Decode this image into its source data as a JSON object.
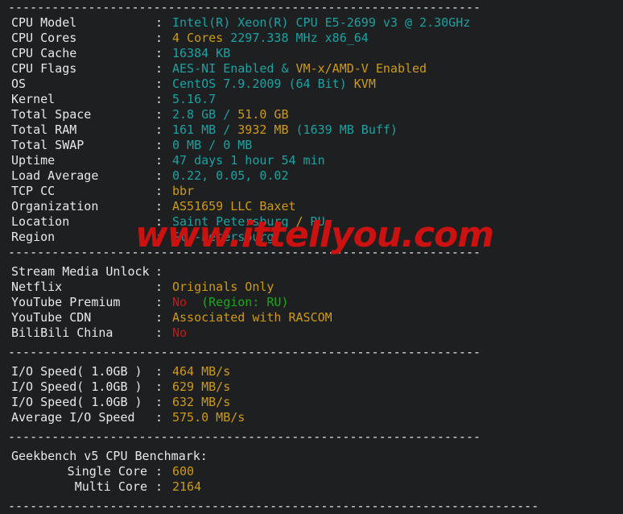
{
  "terminal": {
    "separator": "-----------------------------------------------------------------",
    "separator_long": "-------------------------------------------------------------------------"
  },
  "watermark": {
    "text": "www.ittellyou.com",
    "color": "#cc1111"
  },
  "colors": {
    "background": "#1d1f21",
    "label": "#e8e8e8",
    "cyan": "#1ba2a2",
    "amber": "#cf9a14",
    "red": "#cc1515",
    "green": "#1aa81a"
  },
  "system": {
    "rows": [
      {
        "label": "CPU Model",
        "parts": [
          {
            "text": "Intel(R) Xeon(R) CPU E5-2699 v3 @ 2.30GHz",
            "color": "cy"
          }
        ]
      },
      {
        "label": "CPU Cores",
        "parts": [
          {
            "text": "4 Cores ",
            "color": "am"
          },
          {
            "text": "2297.338 MHz x86_64",
            "color": "cy"
          }
        ]
      },
      {
        "label": "CPU Cache",
        "parts": [
          {
            "text": "16384 KB",
            "color": "cy"
          }
        ]
      },
      {
        "label": "CPU Flags",
        "parts": [
          {
            "text": "AES-NI Enabled ",
            "color": "cy"
          },
          {
            "text": "& ",
            "color": "cy"
          },
          {
            "text": "VM-x/AMD-V Enabled",
            "color": "am"
          }
        ]
      },
      {
        "label": "OS",
        "parts": [
          {
            "text": "CentOS 7.9.2009 (64 Bit) ",
            "color": "cy"
          },
          {
            "text": "KVM",
            "color": "am"
          }
        ]
      },
      {
        "label": "Kernel",
        "parts": [
          {
            "text": "5.16.7",
            "color": "cy"
          }
        ]
      },
      {
        "label": "Total Space",
        "parts": [
          {
            "text": "2.8 GB ",
            "color": "cy"
          },
          {
            "text": "/ ",
            "color": "cy"
          },
          {
            "text": "51.0 GB",
            "color": "am"
          }
        ]
      },
      {
        "label": "Total RAM",
        "parts": [
          {
            "text": "161 MB ",
            "color": "cy"
          },
          {
            "text": "/ ",
            "color": "cy"
          },
          {
            "text": "3932 MB ",
            "color": "am"
          },
          {
            "text": "(1639 MB Buff)",
            "color": "cy"
          }
        ]
      },
      {
        "label": "Total SWAP",
        "parts": [
          {
            "text": "0 MB ",
            "color": "cy"
          },
          {
            "text": "/ ",
            "color": "cy"
          },
          {
            "text": "0 MB",
            "color": "cy"
          }
        ]
      },
      {
        "label": "Uptime",
        "parts": [
          {
            "text": "47 days 1 hour 54 min",
            "color": "cy"
          }
        ]
      },
      {
        "label": "Load Average",
        "parts": [
          {
            "text": "0.22, 0.05, 0.02",
            "color": "cy"
          }
        ]
      },
      {
        "label": "TCP CC",
        "parts": [
          {
            "text": "bbr",
            "color": "am"
          }
        ]
      },
      {
        "label": "Organization",
        "parts": [
          {
            "text": "AS51659 LLC Baxet",
            "color": "am"
          }
        ]
      },
      {
        "label": "Location",
        "parts": [
          {
            "text": "Saint Petersburg ",
            "color": "cy"
          },
          {
            "text": "/ ",
            "color": "am"
          },
          {
            "text": "RU",
            "color": "cy"
          }
        ]
      },
      {
        "label": "Region",
        "parts": [
          {
            "text": "St.-Petersburg",
            "color": "cy"
          }
        ]
      }
    ]
  },
  "stream": {
    "header_label": "Stream Media Unlock",
    "header_value": "",
    "rows": [
      {
        "label": "Netflix",
        "parts": [
          {
            "text": "Originals Only",
            "color": "am"
          }
        ]
      },
      {
        "label": "YouTube Premium",
        "parts": [
          {
            "text": "No",
            "color": "rd"
          },
          {
            "text": "  ",
            "color": "wt"
          },
          {
            "text": "(Region: RU)",
            "color": "gn"
          }
        ]
      },
      {
        "label": "YouTube CDN",
        "parts": [
          {
            "text": "Associated with RASCOM",
            "color": "am"
          }
        ]
      },
      {
        "label": "BiliBili China",
        "parts": [
          {
            "text": "No",
            "color": "rd"
          }
        ]
      }
    ]
  },
  "io": {
    "rows": [
      {
        "label": "I/O Speed( 1.0GB )",
        "parts": [
          {
            "text": "464 MB/s",
            "color": "am"
          }
        ]
      },
      {
        "label": "I/O Speed( 1.0GB )",
        "parts": [
          {
            "text": "629 MB/s",
            "color": "am"
          }
        ]
      },
      {
        "label": "I/O Speed( 1.0GB )",
        "parts": [
          {
            "text": "632 MB/s",
            "color": "am"
          }
        ]
      },
      {
        "label": "Average I/O Speed",
        "parts": [
          {
            "text": "575.0 MB/s",
            "color": "am"
          }
        ]
      }
    ]
  },
  "benchmark": {
    "title": "Geekbench v5 CPU Benchmark:",
    "rows": [
      {
        "label": "Single Core",
        "parts": [
          {
            "text": "600",
            "color": "am"
          }
        ]
      },
      {
        "label": "Multi Core",
        "parts": [
          {
            "text": "2164",
            "color": "am"
          }
        ]
      }
    ]
  }
}
